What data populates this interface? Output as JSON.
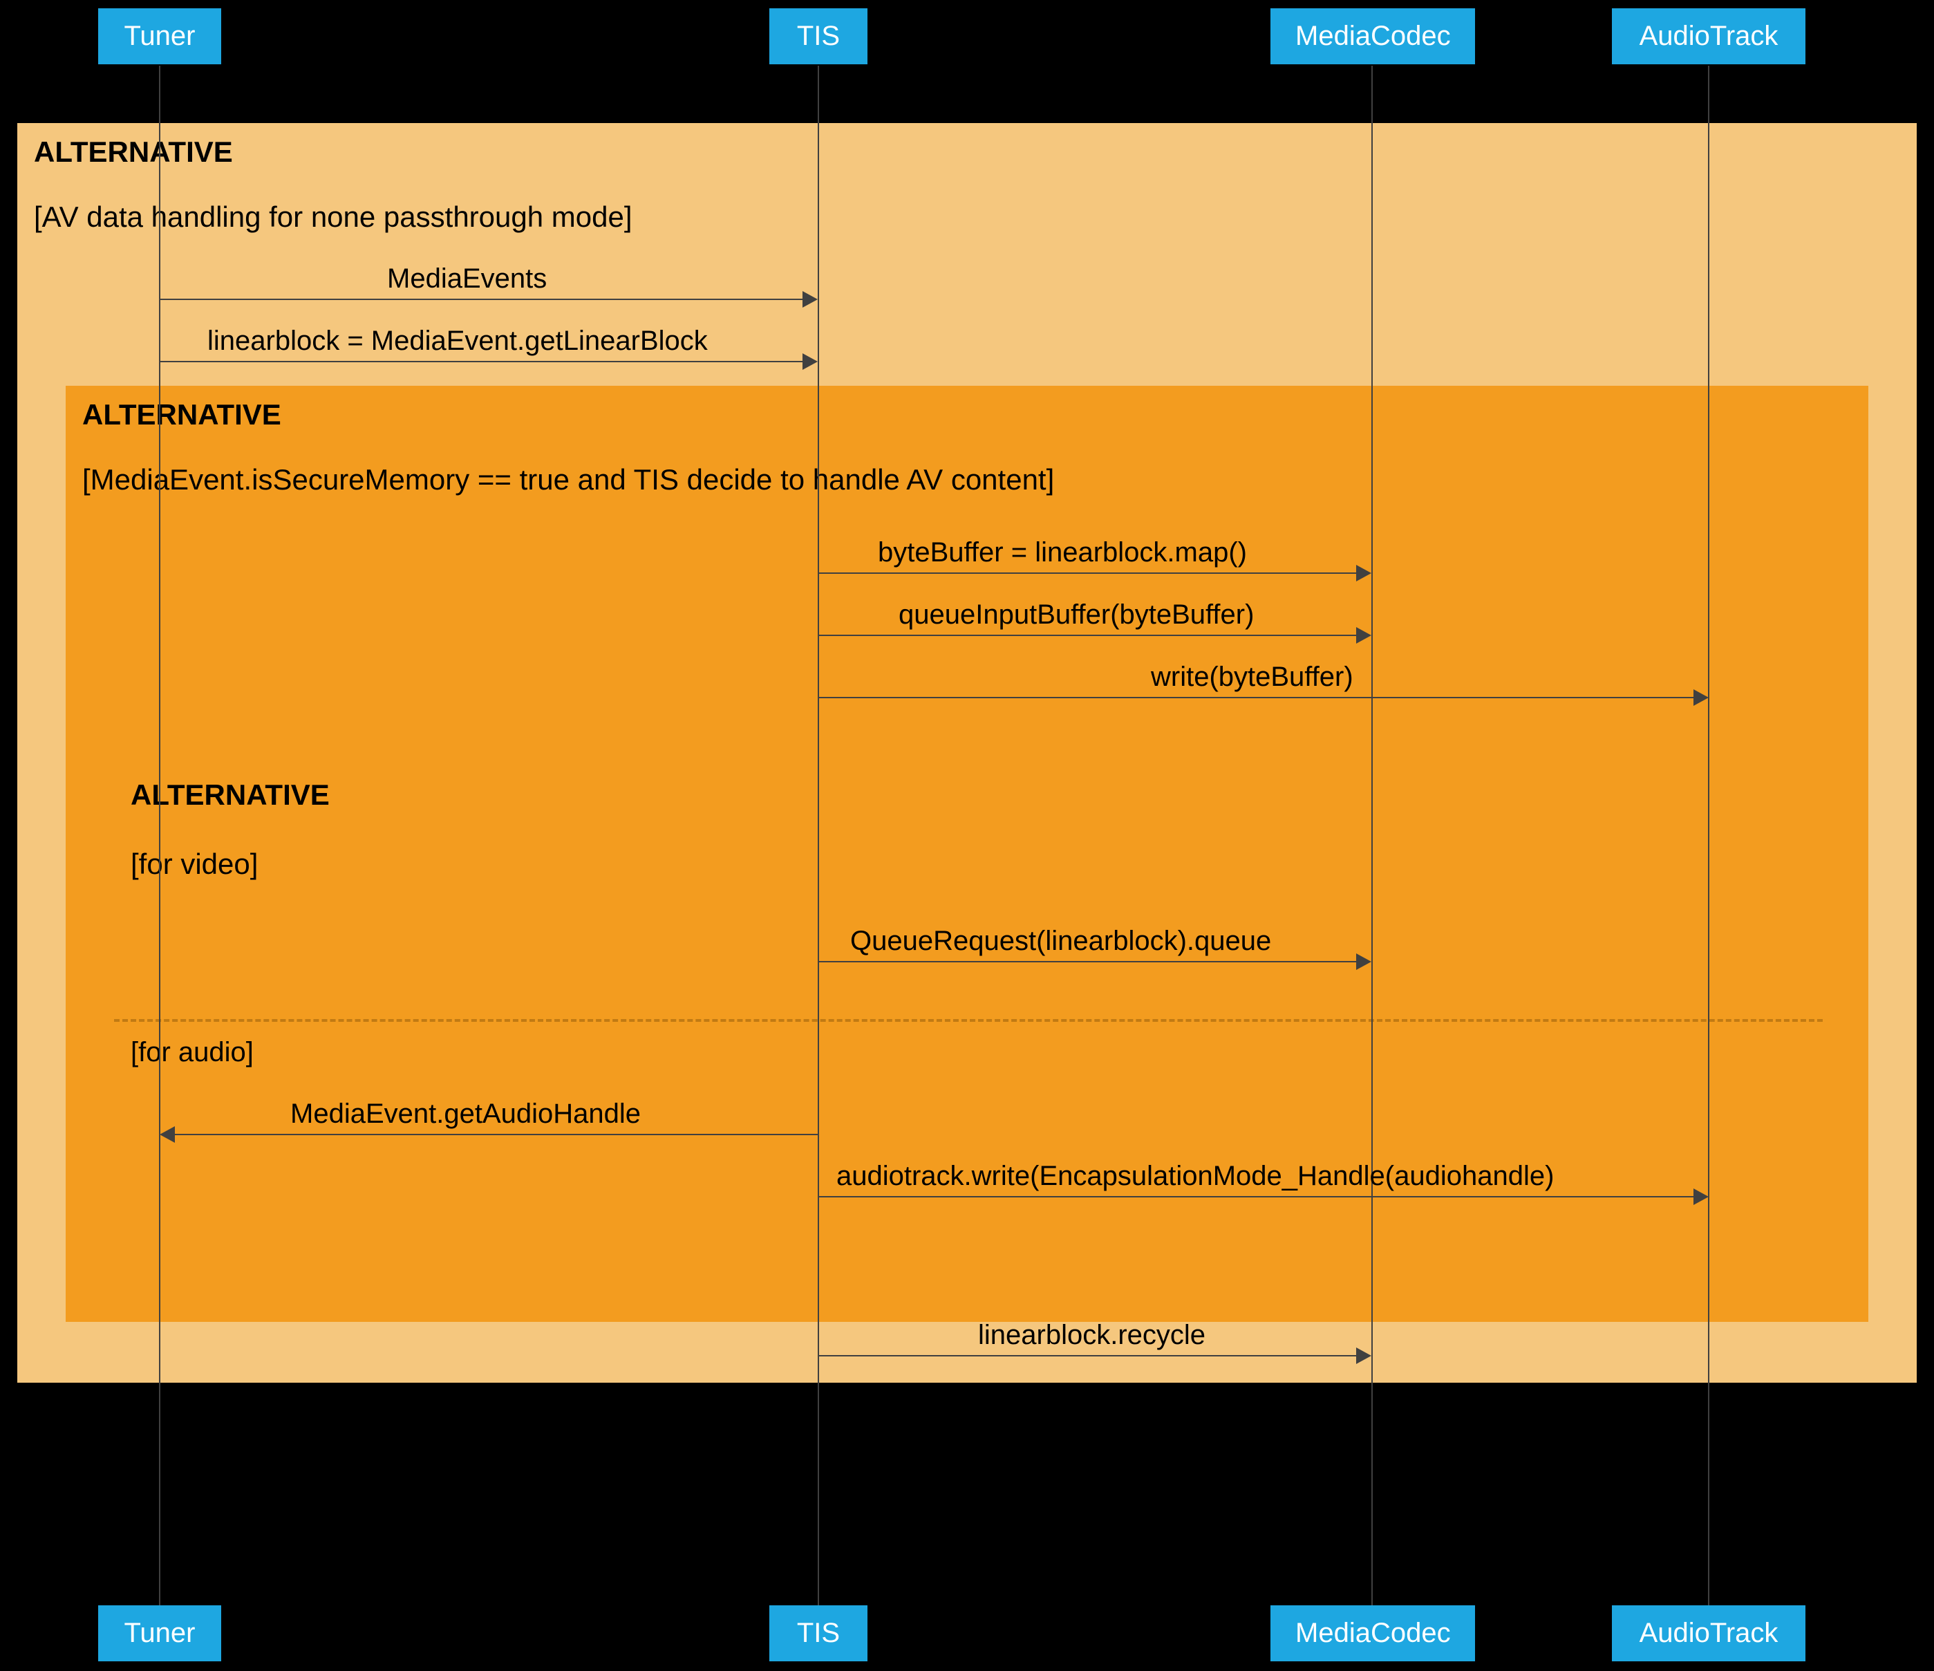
{
  "participants": {
    "tuner": "Tuner",
    "tis": "TIS",
    "mediacodec": "MediaCodec",
    "audiotrack": "AudioTrack"
  },
  "alt1": {
    "title": "ALTERNATIVE",
    "cond": "[AV data handling for none passthrough mode]"
  },
  "alt2": {
    "title": "ALTERNATIVE",
    "cond": "[MediaEvent.isSecureMemory == true and TIS decide to handle AV content]"
  },
  "alt3": {
    "title": "ALTERNATIVE",
    "cond_a": "[for video]",
    "cond_b": "[for audio]"
  },
  "messages": {
    "m1": "MediaEvents",
    "m2": "linearblock = MediaEvent.getLinearBlock",
    "m3": "byteBuffer = linearblock.map()",
    "m4": "queueInputBuffer(byteBuffer)",
    "m5": "write(byteBuffer)",
    "m6": "QueueRequest(linearblock).queue",
    "m7": "MediaEvent.getAudioHandle",
    "m8": "audiotrack.write(EncapsulationMode_Handle(audiohandle)",
    "m9": "linearblock.recycle"
  }
}
